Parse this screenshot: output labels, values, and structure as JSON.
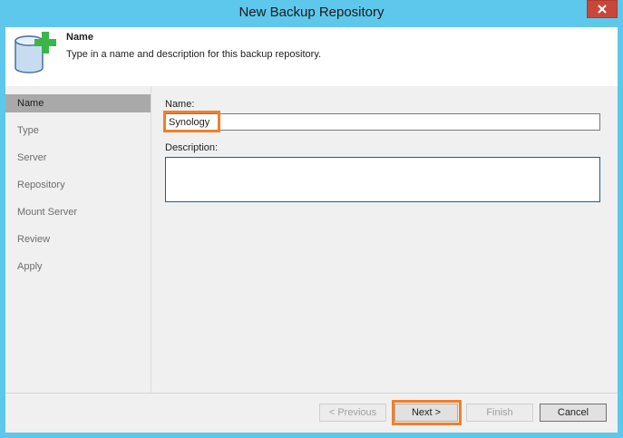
{
  "window": {
    "title": "New Backup Repository",
    "close_icon": "close-icon"
  },
  "header": {
    "icon": "database-add-icon",
    "title": "Name",
    "description": "Type in a name and description for this backup repository."
  },
  "sidebar": {
    "items": [
      {
        "label": "Name",
        "active": true
      },
      {
        "label": "Type",
        "active": false
      },
      {
        "label": "Server",
        "active": false
      },
      {
        "label": "Repository",
        "active": false
      },
      {
        "label": "Mount Server",
        "active": false
      },
      {
        "label": "Review",
        "active": false
      },
      {
        "label": "Apply",
        "active": false
      }
    ]
  },
  "form": {
    "name_label": "Name:",
    "name_value": "Synology",
    "description_label": "Description:",
    "description_value": ""
  },
  "buttons": {
    "previous": "< Previous",
    "next": "Next >",
    "finish": "Finish",
    "cancel": "Cancel"
  },
  "colors": {
    "title_bar": "#5ec7ec",
    "highlight": "#f07f2a",
    "close_button": "#c7483b",
    "active_nav": "#a9a9a9"
  }
}
